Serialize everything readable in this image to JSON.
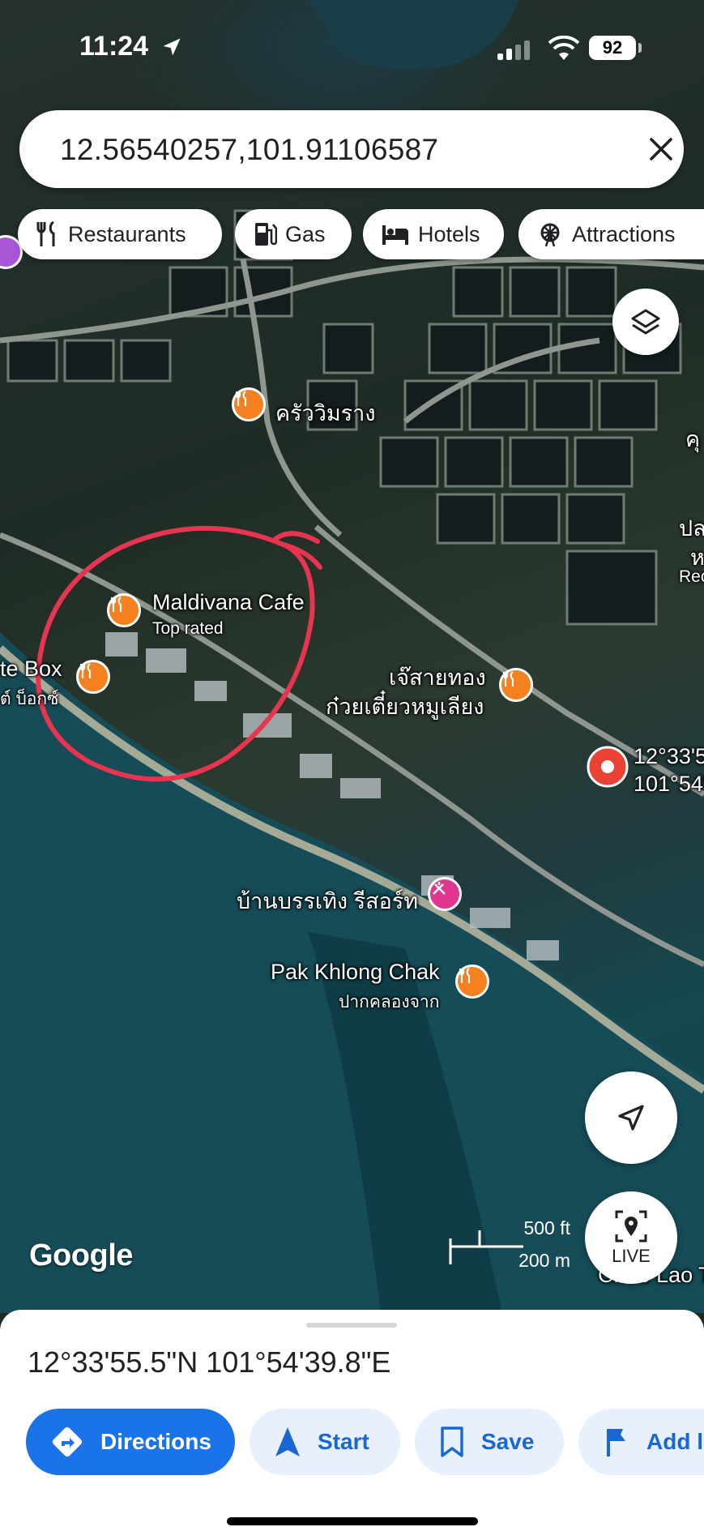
{
  "status_bar": {
    "time": "11:24",
    "battery": "92"
  },
  "search": {
    "query": "12.56540257,101.91106587"
  },
  "chips": [
    {
      "label": "Restaurants",
      "icon": "fork-knife-icon"
    },
    {
      "label": "Gas",
      "icon": "gas-pump-icon"
    },
    {
      "label": "Hotels",
      "icon": "bed-icon"
    },
    {
      "label": "Attractions",
      "icon": "ferris-wheel-icon"
    }
  ],
  "map": {
    "places": [
      {
        "name": "ครัววิมราง"
      },
      {
        "name": "Maldivana Cafe",
        "sub": "Top rated"
      },
      {
        "name": "te Box",
        "sub": "ต์ บ็อกซ์"
      },
      {
        "name": "เจ๊สายทอง",
        "sub": "ก๋วยเตี๋ยวหมูเลียง"
      },
      {
        "name": "12°33'5",
        "sub": "101°54'"
      },
      {
        "name": "บ้านบรรเทิง รีสอร์ท"
      },
      {
        "name": "Pak Khlong Chak",
        "sub": "ปากคลองจาก"
      },
      {
        "name": "คุ"
      },
      {
        "name": "ปล",
        "sub": "ห"
      },
      {
        "name": "Rec"
      },
      {
        "name": "Chao Lao T"
      }
    ],
    "scale_ft": "500 ft",
    "scale_m": "200 m",
    "google_logo": "Google",
    "live_label": "LIVE",
    "annotation_color": "#e8344e"
  },
  "sheet": {
    "coordinates": "12°33'55.5\"N 101°54'39.8\"E",
    "actions": [
      {
        "label": "Directions",
        "icon": "directions-icon"
      },
      {
        "label": "Start",
        "icon": "navigation-arrow-icon"
      },
      {
        "label": "Save",
        "icon": "bookmark-icon"
      },
      {
        "label": "Add l",
        "icon": "flag-icon"
      }
    ]
  },
  "colors": {
    "accent": "#1a73e8",
    "pin_orange": "#f4801f",
    "pin_red": "#ea4335",
    "pin_pink": "#e0368f"
  }
}
